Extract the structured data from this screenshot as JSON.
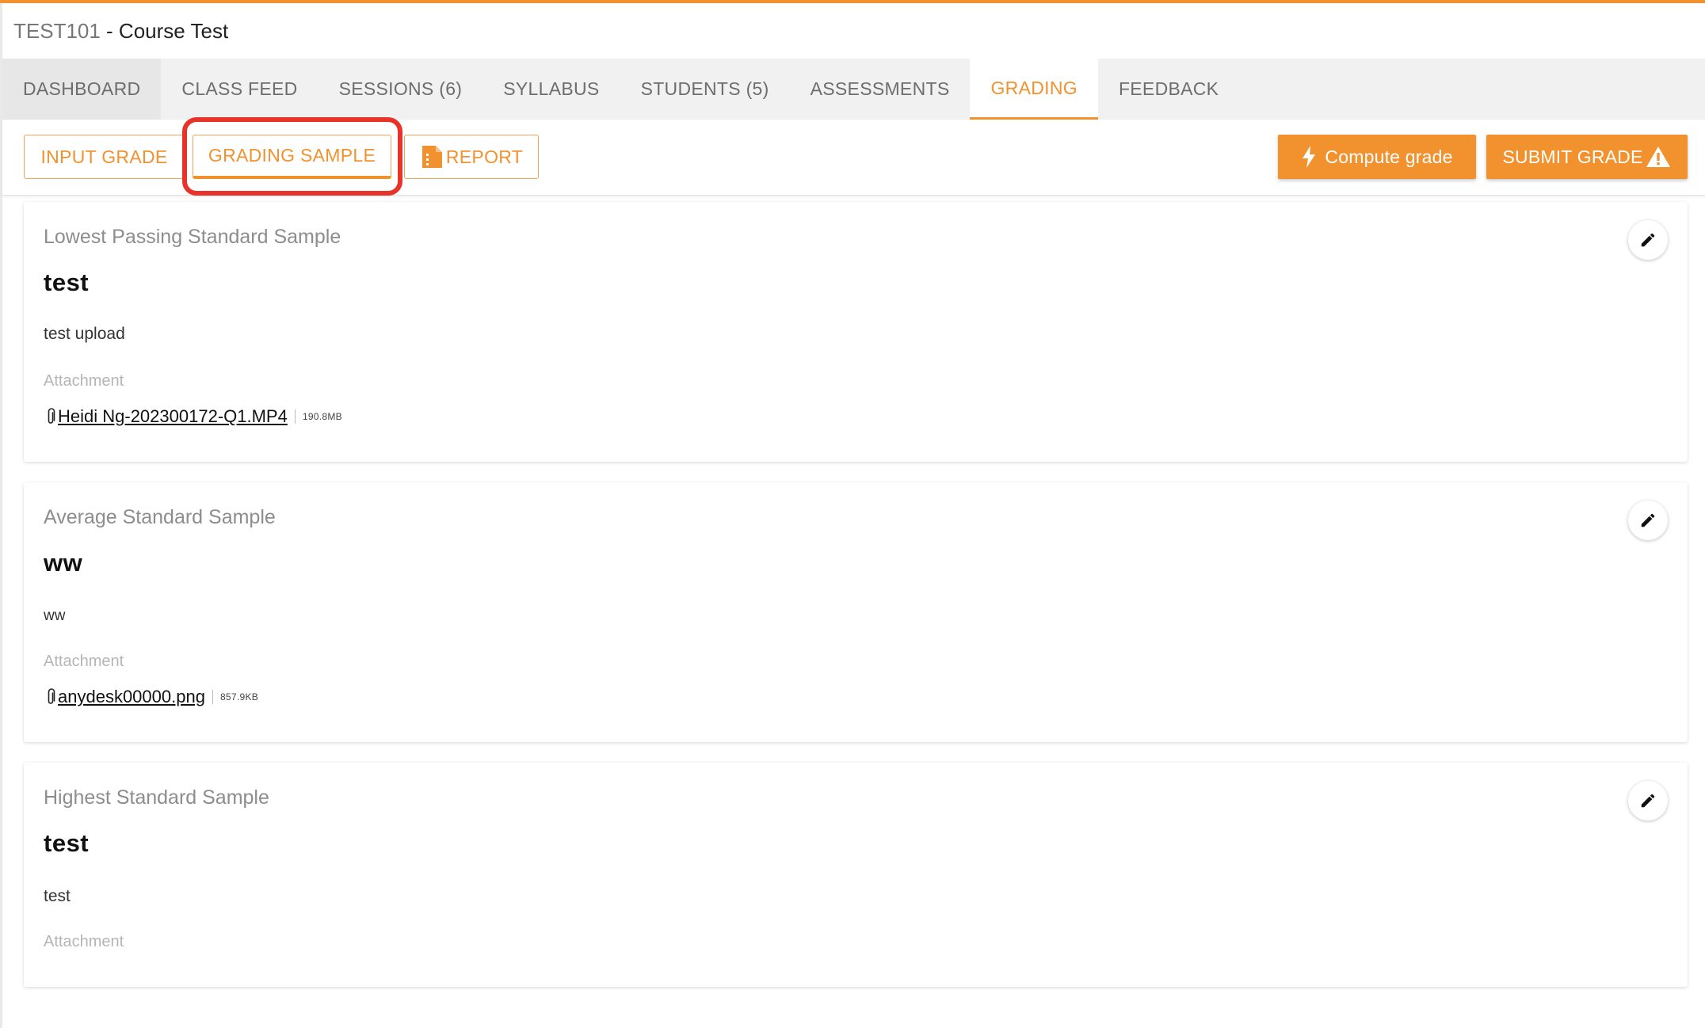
{
  "header": {
    "course_code": "TEST101",
    "course_name": " - Course Test"
  },
  "tabs": [
    {
      "label": "DASHBOARD"
    },
    {
      "label": "CLASS FEED"
    },
    {
      "label": "SESSIONS (6)"
    },
    {
      "label": "SYLLABUS"
    },
    {
      "label": "STUDENTS (5)"
    },
    {
      "label": "ASSESSMENTS"
    },
    {
      "label": "GRADING",
      "active": true
    },
    {
      "label": "FEEDBACK"
    }
  ],
  "toolbar": {
    "input_grade": "INPUT GRADE",
    "grading_sample": "GRADING SAMPLE",
    "report": "REPORT",
    "compute_grade": "Compute grade",
    "submit_grade": "SUBMIT GRADE"
  },
  "samples": [
    {
      "category": "Lowest Passing Standard Sample",
      "title": "test",
      "description": "test upload",
      "attachment_label": "Attachment",
      "attachment_name": "Heidi Ng-202300172-Q1.MP4",
      "attachment_size": "190.8MB"
    },
    {
      "category": "Average Standard Sample",
      "title": "ww",
      "description": "ww",
      "attachment_label": "Attachment",
      "attachment_name": "anydesk00000.png",
      "attachment_size": "857.9KB"
    },
    {
      "category": "Highest Standard Sample",
      "title": "test",
      "description": "test",
      "attachment_label": "Attachment"
    }
  ],
  "colors": {
    "accent": "#f2922f",
    "highlight": "#e8332a"
  },
  "icons": [
    "bolt-icon",
    "warning-icon",
    "report-icon",
    "paperclip-icon",
    "pencil-icon"
  ]
}
